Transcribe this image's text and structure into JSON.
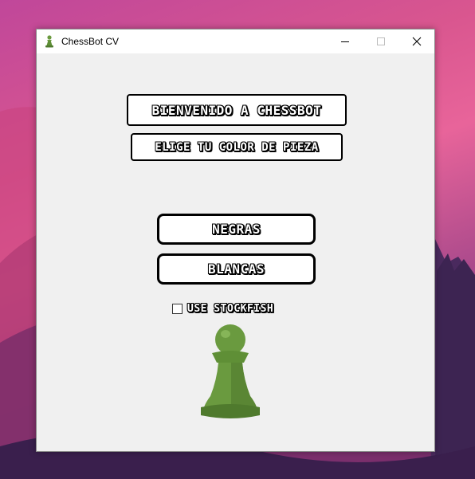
{
  "window": {
    "title": "ChessBot CV",
    "icon": "pawn-icon",
    "controls": [
      "minimize-icon",
      "maximize-icon",
      "close-icon"
    ]
  },
  "main": {
    "welcome": "BIENVENIDO A CHESSBOT",
    "choose": "ELIGE TU COLOR DE PIEZA",
    "black_button": "NEGRAS",
    "white_button": "BLANCAS",
    "stockfish_label": "USE STOCKFISH",
    "stockfish_checked": false,
    "piece_image": "pawn-icon"
  },
  "colors": {
    "pawn_green": "#6a9a3f",
    "pawn_dark": "#4f7a2d",
    "window_bg": "#f0f0f0"
  }
}
